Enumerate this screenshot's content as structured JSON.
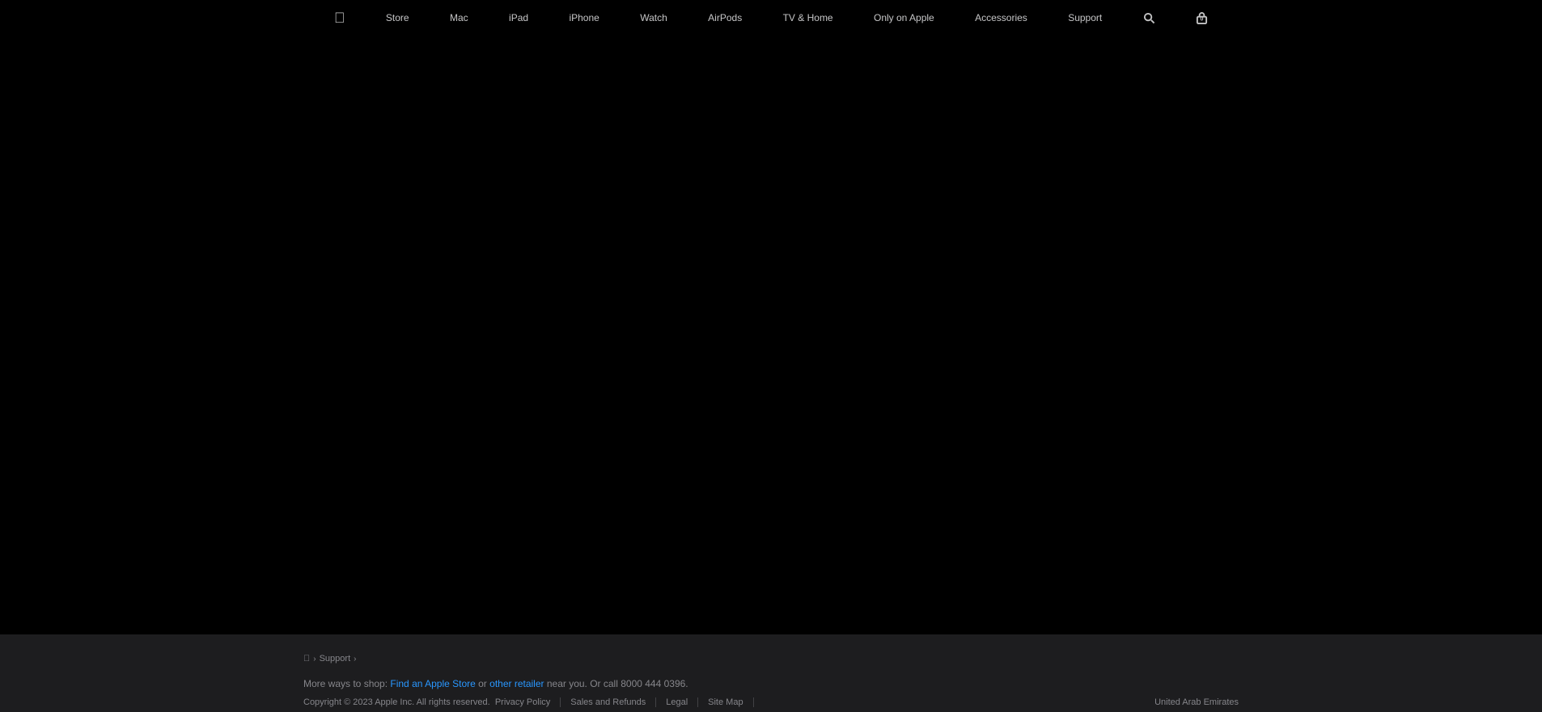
{
  "nav": {
    "apple_logo": "&#63743;",
    "items": [
      {
        "label": "Store",
        "id": "nav-store"
      },
      {
        "label": "Mac",
        "id": "nav-mac"
      },
      {
        "label": "iPad",
        "id": "nav-ipad"
      },
      {
        "label": "iPhone",
        "id": "nav-iphone"
      },
      {
        "label": "Watch",
        "id": "nav-watch"
      },
      {
        "label": "AirPods",
        "id": "nav-airpods"
      },
      {
        "label": "TV & Home",
        "id": "nav-tv-home"
      },
      {
        "label": "Only on Apple",
        "id": "nav-only-on-apple"
      },
      {
        "label": "Accessories",
        "id": "nav-accessories"
      },
      {
        "label": "Support",
        "id": "nav-support"
      }
    ],
    "bag_count": "0"
  },
  "breadcrumb": {
    "home_label": "&#63743;",
    "separator": "›",
    "support_label": "Support",
    "separator2": "›"
  },
  "footer": {
    "more_ways_text": "More ways to shop: ",
    "find_store_label": "Find an Apple Store",
    "or_text": " or ",
    "other_retailer_label": "other retailer",
    "near_you_text": " near you. Or call 8000 444 0396.",
    "copyright": "Copyright © 2023 Apple Inc. All rights reserved.",
    "links": [
      {
        "label": "Privacy Policy"
      },
      {
        "label": "Sales and Refunds"
      },
      {
        "label": "Legal"
      },
      {
        "label": "Site Map"
      }
    ],
    "country": "United Arab Emirates"
  }
}
